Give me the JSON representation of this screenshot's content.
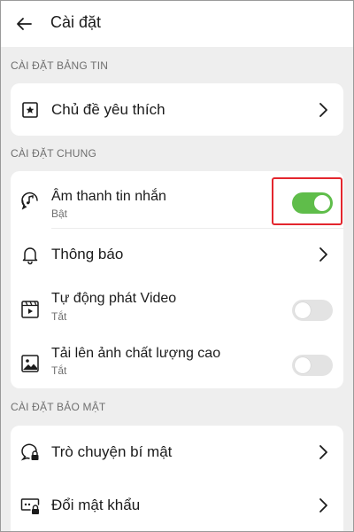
{
  "header": {
    "title": "Cài đặt",
    "back_icon": "arrow-left-icon"
  },
  "sections": {
    "feed": {
      "label": "CÀI ĐẶT BẢNG TIN",
      "items": [
        {
          "title": "Chủ đề yêu thích",
          "icon": "star-icon"
        }
      ]
    },
    "general": {
      "label": "CÀI ĐẶT CHUNG",
      "items": [
        {
          "title": "Âm thanh tin nhắn",
          "subtitle": "Bật",
          "icon": "music-chat-icon",
          "toggle": true
        },
        {
          "title": "Thông báo",
          "icon": "bell-icon"
        },
        {
          "title": "Tự động phát Video",
          "subtitle": "Tắt",
          "icon": "video-play-icon",
          "toggle": false
        },
        {
          "title": "Tải lên ảnh chất lượng cao",
          "subtitle": "Tắt",
          "icon": "image-icon",
          "toggle": false
        }
      ]
    },
    "security": {
      "label": "CÀI ĐẶT BẢO MẬT",
      "items": [
        {
          "title": "Trò chuyện bí mật",
          "icon": "lock-chat-icon"
        },
        {
          "title": "Đổi mật khẩu",
          "icon": "password-lock-icon"
        }
      ]
    }
  },
  "colors": {
    "toggle_on": "#5fbd4a",
    "toggle_off": "#e3e3e3",
    "highlight": "#e3262e",
    "background": "#eeeeee"
  }
}
